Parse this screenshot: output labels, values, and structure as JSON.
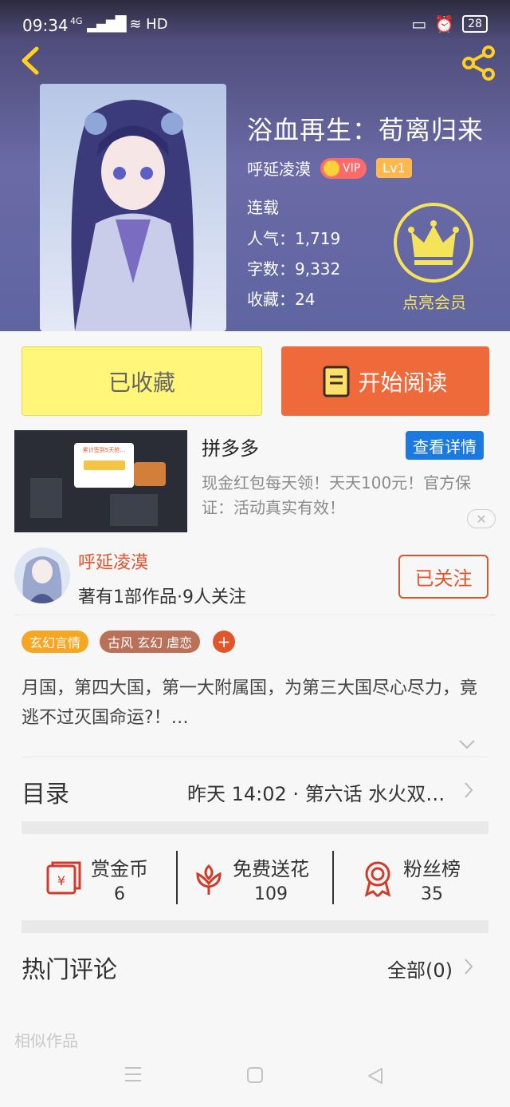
{
  "status_bar": {
    "time": "09:34",
    "signal": "4G",
    "network": "HD",
    "battery": "28"
  },
  "book": {
    "title": "浴血再生：荀离归来",
    "author": "呼延凌漠",
    "vip_label": "VIP",
    "level": "Lv1",
    "status": "连载",
    "popularity": "人气：1,719",
    "word_count": "字数：9,332",
    "favorites": "收藏：24",
    "member_label": "点亮会员"
  },
  "actions": {
    "favorited": "已收藏",
    "start_reading": "开始阅读"
  },
  "ad": {
    "title": "拼多多",
    "detail_button": "查看详情",
    "description": "现金红包每天领！天天100元！官方保证：活动真实有效！",
    "close": "✕",
    "image_banner": "累计签到5天抢…"
  },
  "author_card": {
    "name": "呼延凌漠",
    "meta": "著有1部作品·9人关注",
    "follow_state": "已关注"
  },
  "tags": [
    {
      "label": "玄幻言情",
      "color": "#f5a623"
    },
    {
      "label": "古风 玄幻 虐恋",
      "color": "#b9715a"
    }
  ],
  "tag_add": "+",
  "summary": "月国，第四大国，第一大附属国，为第三大国尽心尽力，竟逃不过灭国命运?！…",
  "toc": {
    "label": "目录",
    "latest": "昨天 14:02 · 第六话  水火双…"
  },
  "rewards": [
    {
      "label": "赏金币",
      "value": "6",
      "icon": "red-envelope-icon"
    },
    {
      "label": "免费送花",
      "value": "109",
      "icon": "flower-icon"
    },
    {
      "label": "粉丝榜",
      "value": "35",
      "icon": "medal-icon"
    }
  ],
  "comments": {
    "label": "热门评论",
    "all": "全部(0)"
  },
  "similar": {
    "label": "相似作品"
  },
  "colors": {
    "accent": "#ef6a3a",
    "author": "#e0552c",
    "favorite_bg": "#fff67a",
    "vip_gold": "#f5e35a",
    "ad_button": "#1a7ae0"
  }
}
